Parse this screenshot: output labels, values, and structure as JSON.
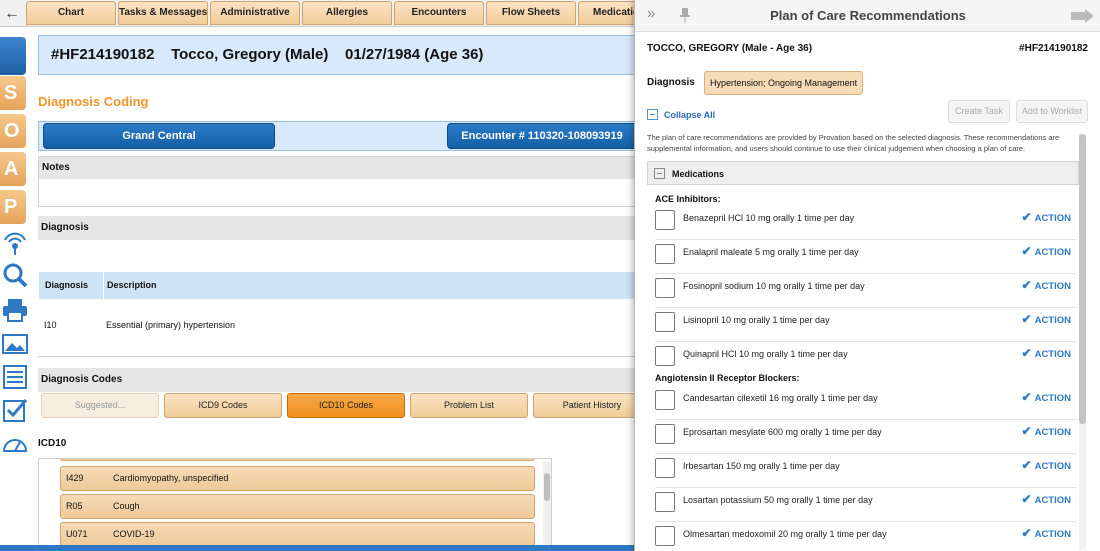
{
  "top_tabs": {
    "back": "←",
    "tabs": [
      "Chart",
      "Tasks & Messages",
      "Administrative",
      "Allergies",
      "Encounters",
      "Flow Sheets",
      "Medications"
    ]
  },
  "rail": {
    "letters": [
      "S",
      "O",
      "A",
      "P"
    ]
  },
  "patient_header": {
    "text": "#HF214190182    Tocco, Gregory (Male)    01/27/1984 (Age 36)"
  },
  "section_title": "Diagnosis Coding",
  "nav": {
    "grand_central": "Grand Central",
    "encounter": "Encounter # 110320-108093919"
  },
  "notes_panel": {
    "title": "Notes"
  },
  "diagnosis_panel": {
    "title": "Diagnosis",
    "col_diagnosis": "Diagnosis",
    "col_description": "Description",
    "row": {
      "code": "I10",
      "description": "Essential (primary) hypertension"
    }
  },
  "diagnosis_codes": {
    "title": "Diagnosis Codes",
    "tabs": [
      "Suggested...",
      "ICD9 Codes",
      "ICD10 Codes",
      "Problem List",
      "Patient History"
    ],
    "active_tab": "ICD10 Codes"
  },
  "icd10": {
    "label": "ICD10",
    "items": [
      {
        "code": "I429",
        "desc": "Cardiomyopathy, unspecified"
      },
      {
        "code": "R05",
        "desc": "Cough"
      },
      {
        "code": "U071",
        "desc": "COVID-19"
      }
    ]
  },
  "plan_panel": {
    "title": "Plan of Care Recommendations",
    "expand_icon": "»",
    "patient_line": "TOCCO, GREGORY (Male - Age 36)",
    "patient_id": "#HF214190182",
    "diagnosis_label": "Diagnosis",
    "diagnosis_value": "Hypertension; Ongoing Management",
    "collapse_all": "Collapse All",
    "create_task": "Create Task",
    "add_to_worklist": "Add to Worklist",
    "note": "The plan of care recommendations are provided by Provation based on the selected diagnosis. These recommendations are supplemental information, and users should continue to use their clinical judgement when choosing a plan of care.",
    "medications_label": "Medications",
    "action_label": "ACTION",
    "groups": [
      {
        "name": "ACE Inhibitors:",
        "items": [
          "Benazepril HCl 10 mg orally 1 time per day",
          "Enalapril maleate 5 mg orally 1 time per day",
          "Fosinopril sodium 10 mg orally 1 time per day",
          "Lisinopril 10 mg orally 1 time per day",
          "Quinapril HCl 10 mg orally 1 time per day"
        ]
      },
      {
        "name": "Angiotensin II Receptor Blockers:",
        "items": [
          "Candesartan cilexetil 16 mg orally 1 time per day",
          "Eprosartan mesylate 600 mg orally 1 time per day",
          "Irbesartan 150 mg orally 1 time per day",
          "Losartan potassium 50 mg orally 1 time per day",
          "Olmesartan medoxomil 20 mg orally 1 time per day"
        ]
      }
    ]
  },
  "colors": {
    "accent_blue": "#2d79c4",
    "accent_orange": "#f0962a",
    "tab_tan": "#f2cd9b"
  }
}
